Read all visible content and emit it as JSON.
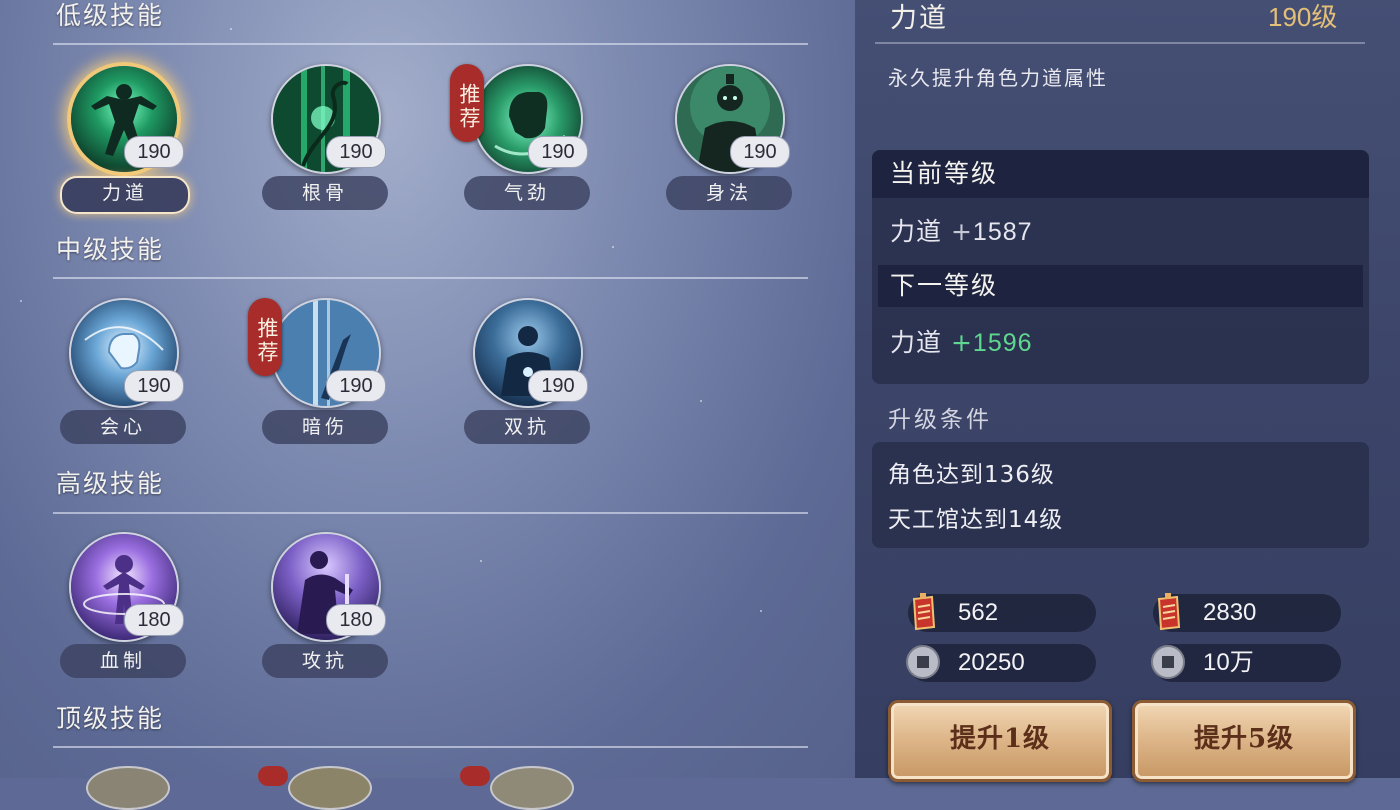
{
  "sections": {
    "low": "低级技能",
    "mid": "中级技能",
    "high": "高级技能",
    "top": "顶级技能"
  },
  "skills": {
    "low": [
      {
        "name": "力道",
        "level": "190",
        "selected": true
      },
      {
        "name": "根骨",
        "level": "190"
      },
      {
        "name": "气劲",
        "level": "190",
        "badge": "推荐"
      },
      {
        "name": "身法",
        "level": "190"
      }
    ],
    "mid": [
      {
        "name": "会心",
        "level": "190"
      },
      {
        "name": "暗伤",
        "level": "190",
        "badge": "推荐"
      },
      {
        "name": "双抗",
        "level": "190"
      }
    ],
    "high": [
      {
        "name": "血制",
        "level": "180"
      },
      {
        "name": "攻抗",
        "level": "180"
      }
    ]
  },
  "detail": {
    "title": "力道",
    "level": "190级",
    "description": "永久提升角色力道属性",
    "current_header": "当前等级",
    "current_attr": "力道",
    "current_plus": "+",
    "current_value": "1587",
    "next_header": "下一等级",
    "next_attr": "力道",
    "next_plus": "+",
    "next_value": "1596",
    "conditions_title": "升级条件",
    "conditions": [
      "角色达到136级",
      "天工馆达到14级"
    ]
  },
  "costs": {
    "one": {
      "token": "562",
      "coin": "20250"
    },
    "five": {
      "token": "2830",
      "coin": "10万"
    }
  },
  "buttons": {
    "upgrade_one": "提升1级",
    "upgrade_five": "提升5级"
  },
  "colors": {
    "accent_gold": "#e4bf78",
    "stat_green": "#5fd88f",
    "badge_red": "#a82d2a"
  },
  "icons": {
    "token": "red-token-icon",
    "coin": "copper-coin-icon"
  }
}
